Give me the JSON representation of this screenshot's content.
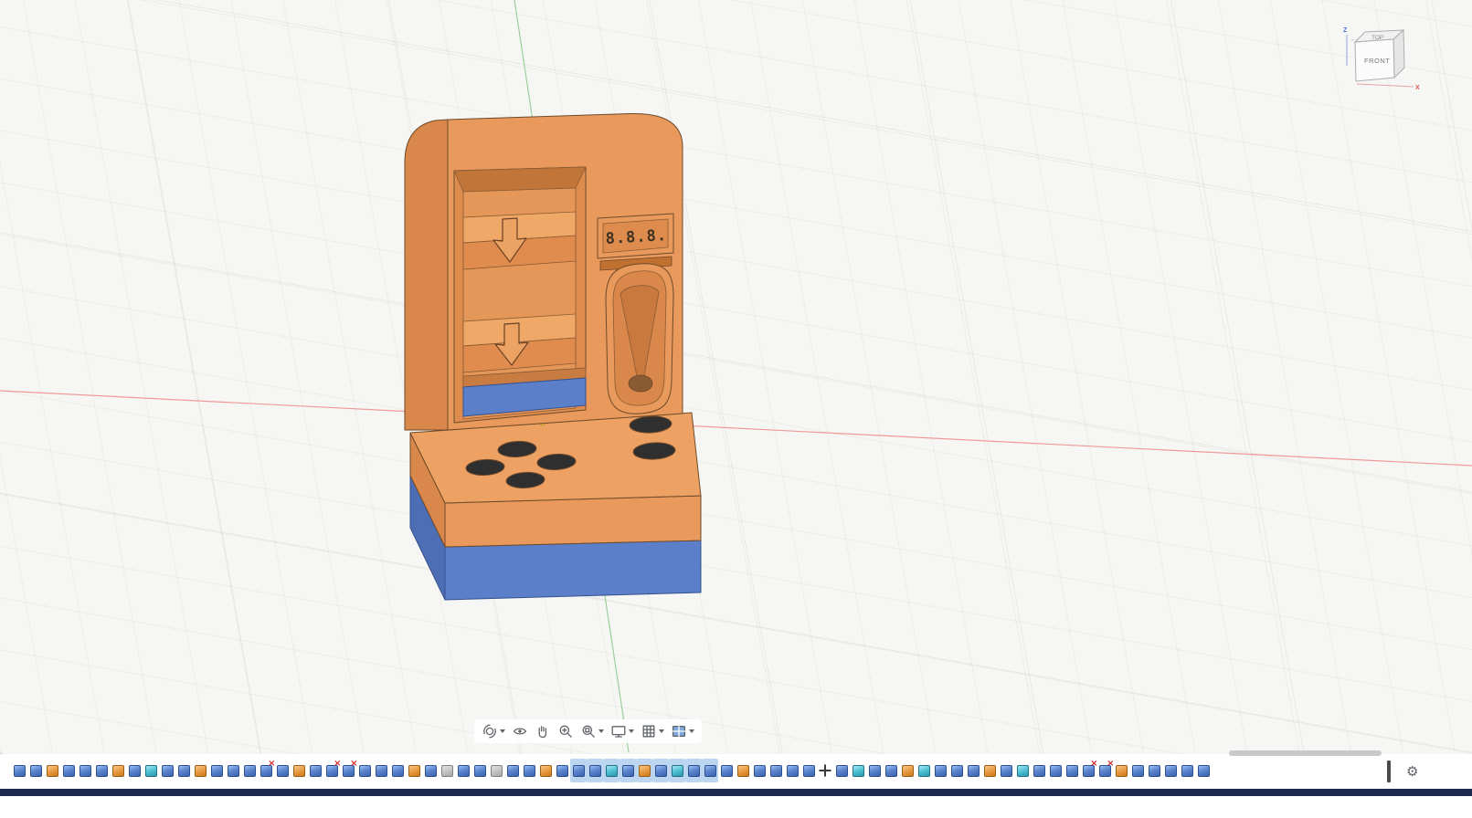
{
  "viewcube": {
    "top_label": "TOP",
    "front_label": "FRONT",
    "z_axis_label": "Z",
    "x_axis_label": "X"
  },
  "model": {
    "display_text": "8.8.8.",
    "body_color": "#E9995B",
    "side_color": "#D9874A",
    "top_color": "#EDA263",
    "base_blue_color": "#5C7FC9"
  },
  "axes": {
    "x_axis_color": "#F09A9A",
    "y_axis_color": "#9CCF9C"
  },
  "nav_toolbar": {
    "items": [
      {
        "name": "orbit",
        "has_dropdown": true
      },
      {
        "name": "look-at",
        "has_dropdown": false
      },
      {
        "name": "pan",
        "has_dropdown": false
      },
      {
        "name": "zoom",
        "has_dropdown": false
      },
      {
        "name": "fit",
        "has_dropdown": true
      },
      {
        "name": "display-settings",
        "has_dropdown": true
      },
      {
        "name": "grid-and-snaps",
        "has_dropdown": true
      },
      {
        "name": "viewports",
        "has_dropdown": true
      }
    ]
  },
  "timeline": {
    "gear_glyph": "⚙",
    "type_names": {
      "e": "extrude-feature-blue",
      "o": "body-feature-orange",
      "c": "surface-feature-teal",
      "g": "construction-feature-gray",
      "m": "move-feature"
    },
    "items": [
      "e",
      "e",
      "o",
      "e",
      "e",
      "e",
      "o",
      "e",
      "c",
      "e",
      "e",
      "o",
      "e",
      "e",
      "e",
      "e:x",
      "e",
      "o",
      "e",
      "e:x",
      "e:x",
      "e",
      "e",
      "e",
      "o",
      "e",
      "g",
      "e",
      "e",
      "g",
      "e",
      "e",
      "o",
      "e",
      "e:sel",
      "e:sel",
      "c:sel",
      "e:sel",
      "o:sel",
      "e:sel",
      "c:sel",
      "e:sel",
      "e:sel",
      "e",
      "o",
      "e",
      "e",
      "e",
      "e",
      "m",
      "e",
      "c",
      "e",
      "e",
      "o",
      "c",
      "e",
      "e",
      "e",
      "o",
      "e",
      "c",
      "e",
      "e",
      "e",
      "e:x",
      "e:x",
      "o",
      "e",
      "e",
      "e",
      "e",
      "e"
    ]
  }
}
